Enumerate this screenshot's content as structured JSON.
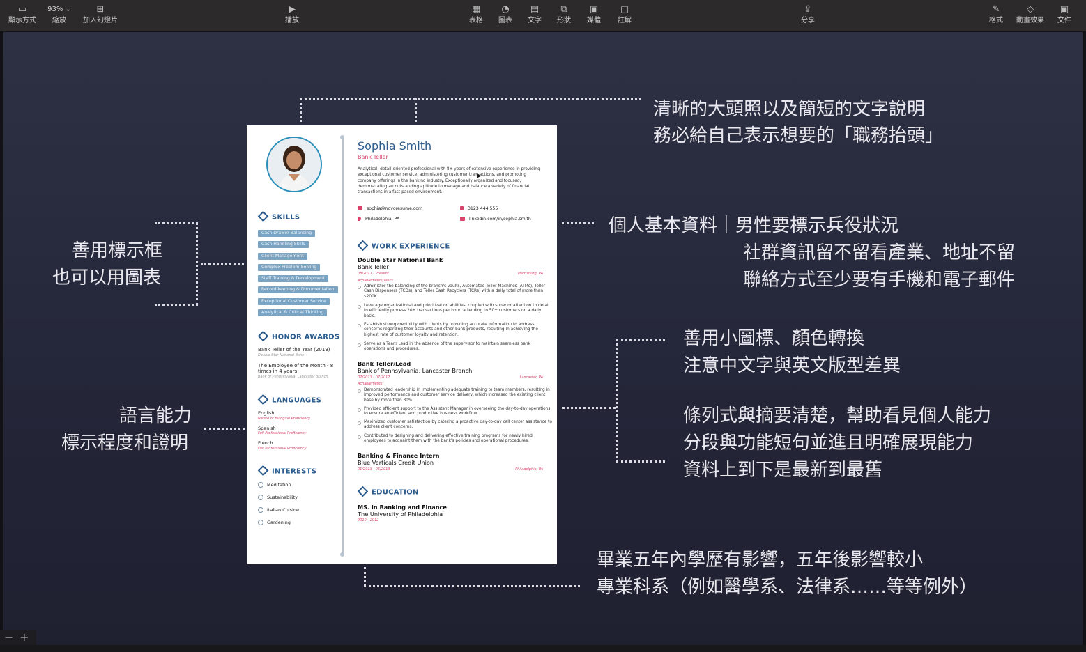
{
  "toolbar": {
    "view": "顯示方式",
    "zoom_value": "93%",
    "zoom": "縮放",
    "add_slide": "加入幻燈片",
    "play": "播放",
    "table": "表格",
    "chart": "圖表",
    "text": "文字",
    "shape": "形狀",
    "media": "媒體",
    "comment": "註解",
    "share": "分享",
    "format": "格式",
    "animate": "動畫效果",
    "document": "文件"
  },
  "annotations": {
    "photo_line1": "清晰的大頭照以及簡短的文字說明",
    "photo_line2": "務必給自己表示想要的「職務抬頭」",
    "contact_line1": "個人基本資料｜男性要標示兵役狀況",
    "contact_line2": "社群資訊留不留看產業、地址不留",
    "contact_line3": "聯絡方式至少要有手機和電子郵件",
    "skills_line1": "善用標示框",
    "skills_line2": "也可以用圖表",
    "icons_line1": "善用小圖標、顏色轉換",
    "icons_line2": "注意中文字與英文版型差異",
    "bullets_line1": "條列式與摘要清楚，幫助看見個人能力",
    "bullets_line2": "分段與功能短句並進且明確展現能力",
    "bullets_line3": "資料上到下是最新到最舊",
    "lang_line1": "語言能力",
    "lang_line2": "標示程度和證明",
    "edu_line1": "畢業五年內學歷有影響，五年後影響較小",
    "edu_line2": "專業科系（例如醫學系、法律系……等等例外）"
  },
  "resume": {
    "name": "Sophia Smith",
    "title": "Bank Teller",
    "summary": "Analytical, detail-oriented professional with 8+ years of extensive experience in providing exceptional customer service, administering customer transactions, and promoting company offerings in the banking industry. Exceptionally organized and focused, demonstrating an outstanding aptitude to manage and balance a variety of financial transactions in a fast-paced environment.",
    "email": "sophia@novoresume.com",
    "phone": "3123 444 555",
    "location": "Philadelphia, PA",
    "linkedin": "linkedin.com/in/sophia.smith",
    "skills_heading": "SKILLS",
    "skills": [
      "Cash Drawer Balancing",
      "Cash Handling Skills",
      "Client Management",
      "Complex Problem-Solving",
      "Staff Training & Development",
      "Record-keeping & Documentation",
      "Exceptional Customer Service",
      "Analytical & Critical Thinking"
    ],
    "awards_heading": "HONOR AWARDS",
    "award1": "Bank Teller of the Year (2019)",
    "award1_sub": "Double Star National Bank",
    "award2a": "The Employee of the Month - 8",
    "award2b": "times in 4 years",
    "award2_sub": "Bank of Pennsylvania, Lancaster Branch",
    "languages_heading": "LANGUAGES",
    "lang1": "English",
    "lang1_level": "Native or Bilingual Proficiency",
    "lang2": "Spanish",
    "lang2_level": "Full Professional Proficiency",
    "lang3": "French",
    "lang3_level": "Full Professional Proficiency",
    "interests_heading": "INTERESTS",
    "interests": [
      "Meditation",
      "Sustainability",
      "Italian Cuisine",
      "Gardening"
    ],
    "work_heading": "WORK EXPERIENCE",
    "job1_title": "Double Star National Bank",
    "job1_role": "Bank Teller",
    "job1_dates": "08/2017 - Present",
    "job1_loc": "Harrisburg, PA",
    "job1_sub": "Achievements/Tasks",
    "job1_b1": "Administer the balancing of the branch's vaults, Automated Teller Machines (ATMs), Teller Cash Dispensers (TCDs), and Teller Cash Recyclers (TCRs) with a daily total of more than $200K.",
    "job1_b2": "Leverage organizational and prioritization abilities, coupled with superior attention to detail to efficiently process 20+ transactions per hour, attending to 50+ customers on a daily basis.",
    "job1_b3": "Establish strong credibility with clients by providing accurate information to address concerns regarding their accounts and other bank products, resulting in achieving the highest rate of customer loyalty and retention.",
    "job1_b4": "Serve as a Team Lead in the absence of the supervisor to maintain seamless bank operations and procedures.",
    "job2_title": "Bank Teller/Lead",
    "job2_role": "Bank of Pennsylvania, Lancaster Branch",
    "job2_dates": "07/2013 - 07/2017",
    "job2_loc": "Lancaster, PA",
    "job2_sub": "Achievements",
    "job2_b1": "Demonstrated leadership in implementing adequate training to team members, resulting in improved performance and customer service delivery, which increased the existing client base by more than 30%.",
    "job2_b2": "Provided efficient support to the Assistant Manager in overseeing the day-to-day operations to ensure an efficient and productive business workflow.",
    "job2_b3": "Maximized customer satisfaction by catering a proactive day-to-day call center assistance to address client concerns.",
    "job2_b4": "Contributed to designing and delivering effective training programs for newly hired employees to acquaint them with the bank's policies and operational procedures.",
    "job3_title": "Banking & Finance Intern",
    "job3_role": "Blue Verticals Credit Union",
    "job3_dates": "01/2013 - 06/2013",
    "job3_loc": "Philadelphia, PA",
    "edu_heading": "EDUCATION",
    "edu_degree": "MS. in Banking and Finance",
    "edu_school": "The University of Philadelphia",
    "edu_dates": "2010 - 2012"
  },
  "colors": {
    "accent": "#2a5b8c",
    "highlight": "#d8436b",
    "chip": "#7ba3c2"
  }
}
